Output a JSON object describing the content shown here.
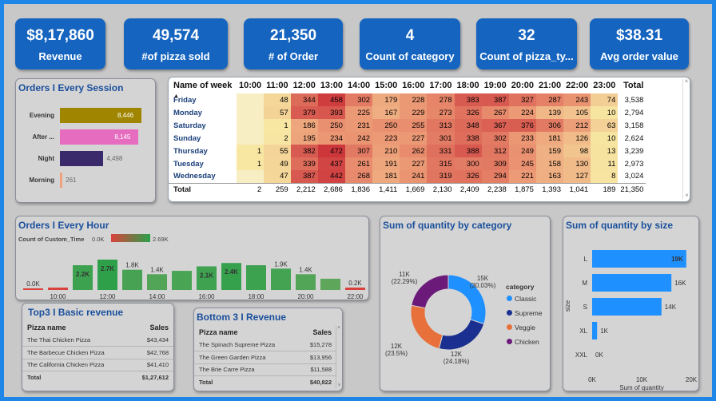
{
  "kpis": [
    {
      "value": "$8,17,860",
      "label": "Revenue"
    },
    {
      "value": "49,574",
      "label": "#of pizza sold"
    },
    {
      "value": "21,350",
      "label": "# of Order"
    },
    {
      "value": "4",
      "label": "Count of category"
    },
    {
      "value": "32",
      "label": "Count of pizza_ty..."
    },
    {
      "value": "$38.31",
      "label": "Avg order value"
    }
  ],
  "session": {
    "title": "Orders I Every Session",
    "rows": [
      {
        "label": "Evening",
        "value": "8,446",
        "color": "#a08600",
        "amount": 8446
      },
      {
        "label": "After ...",
        "value": "8,145",
        "color": "#e66cc0",
        "amount": 8145
      },
      {
        "label": "Night",
        "value": "4,498",
        "color": "#3b2a6b",
        "amount": 4498
      },
      {
        "label": "Morning",
        "value": "261",
        "color": "#f0a07a",
        "amount": 261
      }
    ]
  },
  "heatmap": {
    "corner": "Name of week",
    "hours": [
      "10:00",
      "11:00",
      "12:00",
      "13:00",
      "14:00",
      "15:00",
      "16:00",
      "17:00",
      "18:00",
      "19:00",
      "20:00",
      "21:00",
      "22:00",
      "23:00"
    ],
    "total_header": "Total",
    "rows": [
      {
        "day": "Friday",
        "vals": [
          "",
          "48",
          "344",
          "458",
          "302",
          "179",
          "228",
          "278",
          "383",
          "387",
          "327",
          "287",
          "243",
          "74"
        ],
        "total": "3,538"
      },
      {
        "day": "Monday",
        "vals": [
          "",
          "57",
          "379",
          "393",
          "225",
          "167",
          "229",
          "273",
          "326",
          "267",
          "224",
          "139",
          "105",
          "10"
        ],
        "total": "2,794"
      },
      {
        "day": "Saturday",
        "vals": [
          "",
          "1",
          "186",
          "250",
          "231",
          "250",
          "255",
          "313",
          "348",
          "367",
          "376",
          "306",
          "212",
          "63"
        ],
        "total": "3,158"
      },
      {
        "day": "Sunday",
        "vals": [
          "",
          "2",
          "195",
          "234",
          "242",
          "223",
          "227",
          "301",
          "338",
          "302",
          "233",
          "181",
          "126",
          "10"
        ],
        "total": "2,624"
      },
      {
        "day": "Thursday",
        "vals": [
          "1",
          "55",
          "382",
          "472",
          "307",
          "210",
          "262",
          "331",
          "388",
          "312",
          "249",
          "159",
          "98",
          "13"
        ],
        "total": "3,239"
      },
      {
        "day": "Tuesday",
        "vals": [
          "1",
          "49",
          "339",
          "437",
          "261",
          "191",
          "227",
          "315",
          "300",
          "309",
          "245",
          "158",
          "130",
          "11"
        ],
        "total": "2,973"
      },
      {
        "day": "Wednesday",
        "vals": [
          "",
          "47",
          "387",
          "442",
          "268",
          "181",
          "241",
          "319",
          "326",
          "294",
          "221",
          "163",
          "127",
          "8"
        ],
        "total": "3,024"
      }
    ],
    "totals_label": "Total",
    "totals": [
      "2",
      "259",
      "2,212",
      "2,686",
      "1,836",
      "1,411",
      "1,669",
      "2,130",
      "2,409",
      "2,238",
      "1,875",
      "1,393",
      "1,041",
      "189"
    ],
    "grand_total": "21,350"
  },
  "hourly": {
    "title": "Orders I Every Hour",
    "legend_label": "Count of Custom_Time",
    "legend_min": "0.0K",
    "legend_max": "2.69K",
    "x_ticks": [
      "10:00",
      "12:00",
      "14:00",
      "16:00",
      "18:00",
      "20:00",
      "22:00"
    ],
    "chart_data": {
      "type": "bar",
      "categories": [
        "09:00",
        "10:00",
        "11:00",
        "12:00",
        "13:00",
        "14:00",
        "15:00",
        "16:00",
        "17:00",
        "18:00",
        "19:00",
        "20:00",
        "21:00",
        "22:00",
        "23:00"
      ],
      "values": [
        0,
        0.1,
        2.2,
        2.7,
        1.8,
        1.4,
        1.7,
        2.1,
        2.4,
        2.2,
        1.9,
        1.4,
        1.0,
        0.2,
        0
      ],
      "labels": [
        "0.0K",
        "",
        "2.2K",
        "2.7K",
        "1.8K",
        "1.4K",
        "",
        "2.1K",
        "2.4K",
        "",
        "1.9K",
        "1.4K",
        "",
        "0.2K",
        ""
      ]
    }
  },
  "category": {
    "title": "Sum of quantity by category",
    "legend_title": "category",
    "chart_data": {
      "type": "pie",
      "categories": [
        "Classic",
        "Supreme",
        "Veggie",
        "Chicken"
      ],
      "values": [
        15,
        12,
        12,
        11
      ],
      "labels": [
        "15K\n(30.03%)",
        "12K\n(24.18%)",
        "12K\n(23.5%)",
        "11K\n(22.29%)"
      ],
      "colors": [
        "#1e90ff",
        "#1a2f8f",
        "#e8703a",
        "#6b1a7a"
      ]
    }
  },
  "size": {
    "title": "Sum of quantity by size",
    "ylabel": "size",
    "xlabel": "Sum of quantity",
    "x_ticks": [
      "0K",
      "10K",
      "20K"
    ],
    "chart_data": {
      "type": "bar",
      "categories": [
        "L",
        "M",
        "S",
        "XL",
        "XXL"
      ],
      "values": [
        19,
        16,
        14,
        1,
        0
      ],
      "labels": [
        "19K",
        "16K",
        "14K",
        "1K",
        "0K"
      ],
      "xlim": [
        0,
        20
      ]
    }
  },
  "top3": {
    "title": "Top3 I Basic revenue",
    "col1": "Pizza name",
    "col2": "Sales",
    "rows": [
      {
        "name": "The Thai Chicken Pizza",
        "sales": "$43,434"
      },
      {
        "name": "The Barbecue Chicken Pizza",
        "sales": "$42,768"
      },
      {
        "name": "The California Chicken Pizza",
        "sales": "$41,410"
      }
    ],
    "total_label": "Total",
    "total": "$1,27,612"
  },
  "bottom3": {
    "title": "Bottom 3 I Revenue",
    "col1": "Pizza name",
    "col2": "Sales",
    "rows": [
      {
        "name": "The Spinach Supreme Pizza",
        "sales": "$15,278"
      },
      {
        "name": "The Green Garden Pizza",
        "sales": "$13,956"
      },
      {
        "name": "The Brie Carre Pizza",
        "sales": "$11,588"
      }
    ],
    "total_label": "Total",
    "total": "$40,822"
  }
}
